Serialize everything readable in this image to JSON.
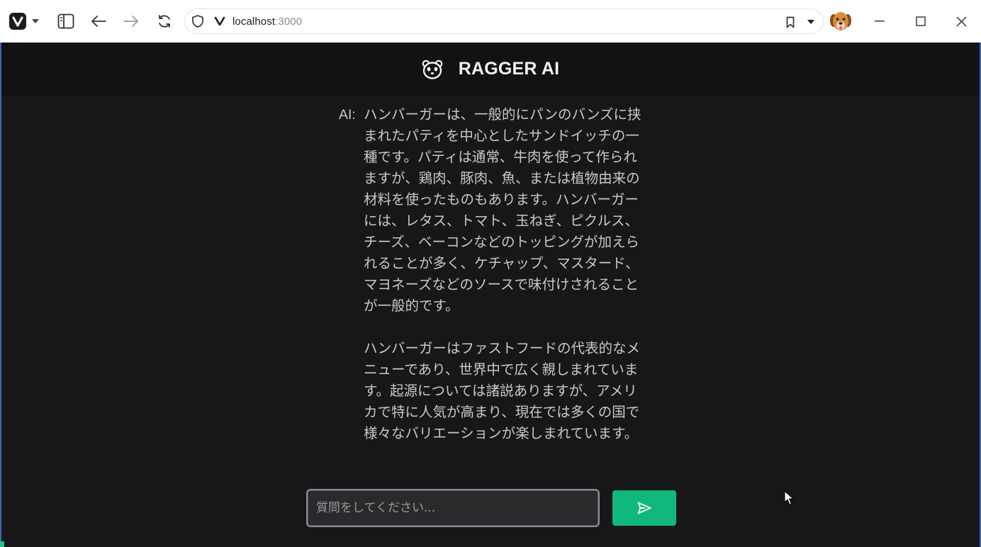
{
  "browser": {
    "url_host": "localhost",
    "url_port": ":3000"
  },
  "app": {
    "title": "RAGGER AI",
    "messages": [
      {
        "speaker": "AI:",
        "text": "ハンバーガーは、一般的にパンのバンズに挟まれたパティを中心としたサンドイッチの一種です。パティは通常、牛肉を使って作られますが、鶏肉、豚肉、魚、または植物由来の材料を使ったものもあります。ハンバーガーには、レタス、トマト、玉ねぎ、ピクルス、チーズ、ベーコンなどのトッピングが加えられることが多く、ケチャップ、マスタード、マヨネーズなどのソースで味付けされることが一般的です。\n\nハンバーガーはファストフードの代表的なメニューであり、世界中で広く親しまれています。起源については諸説ありますが、アメリカで特に人気が高まり、現在では多くの国で様々なバリエーションが楽しまれています。"
      }
    ],
    "input": {
      "placeholder": "質問をしてください...",
      "value": ""
    }
  },
  "colors": {
    "accent": "#10b87c",
    "background": "#171719",
    "header": "#121214",
    "text": "#c9c9cc"
  }
}
